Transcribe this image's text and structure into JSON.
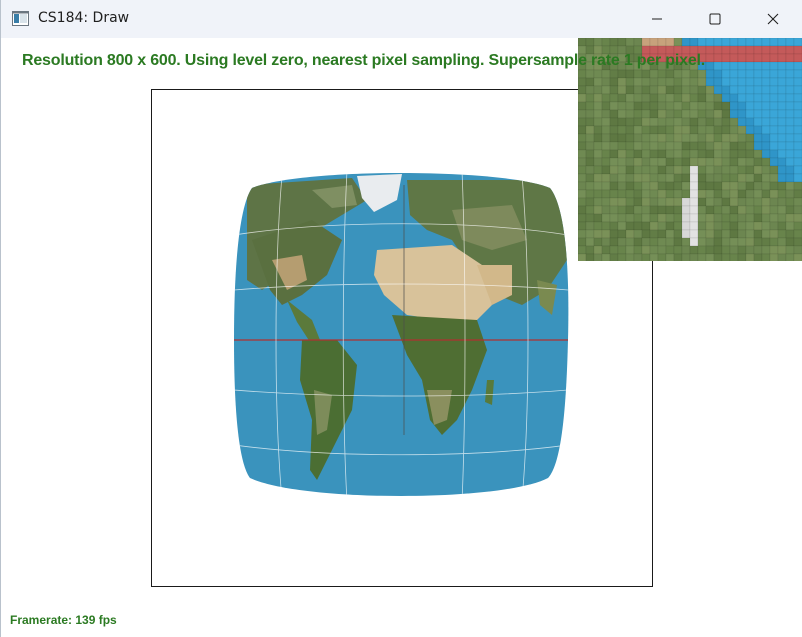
{
  "window": {
    "title": "CS184: Draw",
    "icons": {
      "app": "app-window-icon",
      "minimize": "minimize-icon",
      "maximize": "maximize-icon",
      "close": "close-icon"
    }
  },
  "overlay": {
    "status_text": "Resolution 800 x 600. Using level zero, nearest pixel sampling. Supersample rate 1 per pixel.",
    "framerate": "Framerate: 139 fps"
  },
  "colors": {
    "status_text": "#2b7a22",
    "ocean": "#3a93bd",
    "land_green": "#4f6e3a",
    "desert": "#d8c29a",
    "ice": "#e9ecef",
    "zoom_land": "#6f8a52",
    "zoom_water": "#3aa6d8",
    "equator_line": "#b03030"
  },
  "canvas": {
    "content": "world-map-texture-warped"
  },
  "zoom_view": {
    "content": "magnified-pixel-grid"
  }
}
